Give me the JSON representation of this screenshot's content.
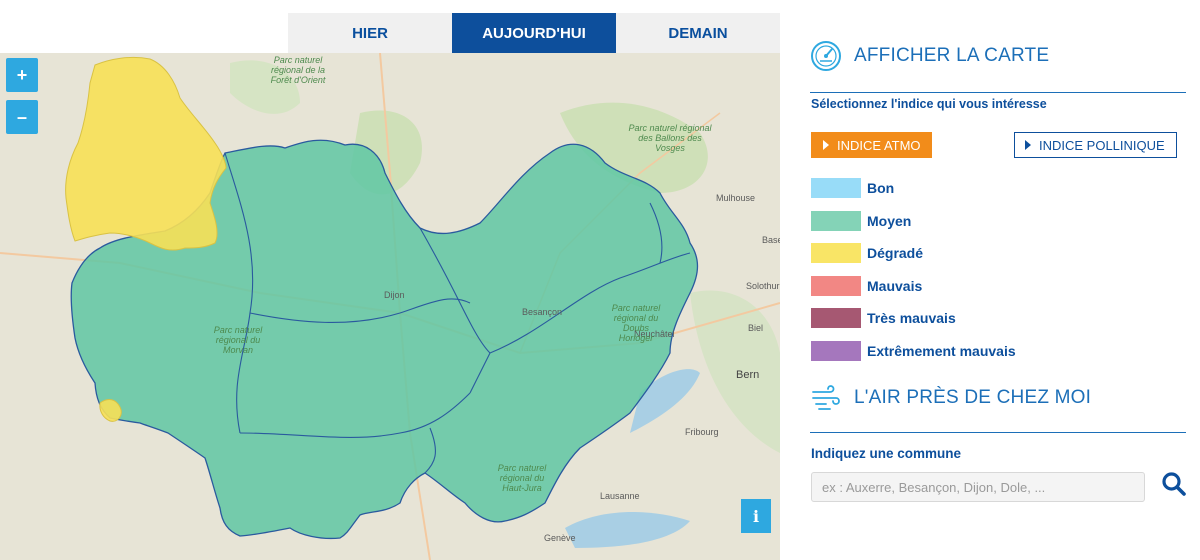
{
  "tabs": [
    {
      "label": "HIER",
      "active": false
    },
    {
      "label": "AUJOURD'HUI",
      "active": true
    },
    {
      "label": "DEMAIN",
      "active": false
    }
  ],
  "map": {
    "zoom_in": "+",
    "zoom_out": "–",
    "info": "i",
    "labels": {
      "mulhouse": "Mulhouse",
      "basel": "Base",
      "bern": "Bern",
      "besancon": "Besançon",
      "dijon": "Dijon",
      "neuchatel": "Neuchâtel",
      "geneve": "Genève",
      "solothurn": "Solothurn",
      "biel": "Biel",
      "fribourg": "Fribourg",
      "lausanne": "Lausanne",
      "park_vosges": "Parc naturel régional des Ballons des Vosges",
      "park_foret_orient": "Parc naturel régional de la Forêt d'Orient",
      "park_morvan": "Parc naturel régional du Morvan",
      "park_doubs": "Parc naturel régional du Doubs Horloger",
      "park_jura": "Parc naturel régional du Haut-Jura"
    },
    "colors": {
      "moyen": "#5fc7a3",
      "degrade": "#f7e057",
      "border": "#2a5a9e"
    }
  },
  "panel": {
    "map_section_title": "AFFICHER LA CARTE",
    "select_index_text": "Sélectionnez l'indice qui vous intéresse",
    "btn_atmo": "INDICE ATMO",
    "btn_pollen": "INDICE POLLINIQUE",
    "legend": [
      {
        "label": "Bon",
        "color": "#98dcf8"
      },
      {
        "label": "Moyen",
        "color": "#84d3b7"
      },
      {
        "label": "Dégradé",
        "color": "#f9e566"
      },
      {
        "label": "Mauvais",
        "color": "#f28784"
      },
      {
        "label": "Très mauvais",
        "color": "#a65872"
      },
      {
        "label": "Extrêmement mauvais",
        "color": "#a577bd"
      }
    ],
    "air_section_title": "L'AIR PRÈS DE CHEZ MOI",
    "commune_label": "Indiquez une commune",
    "search_placeholder": "ex : Auxerre, Besançon, Dijon, Dole, ..."
  }
}
